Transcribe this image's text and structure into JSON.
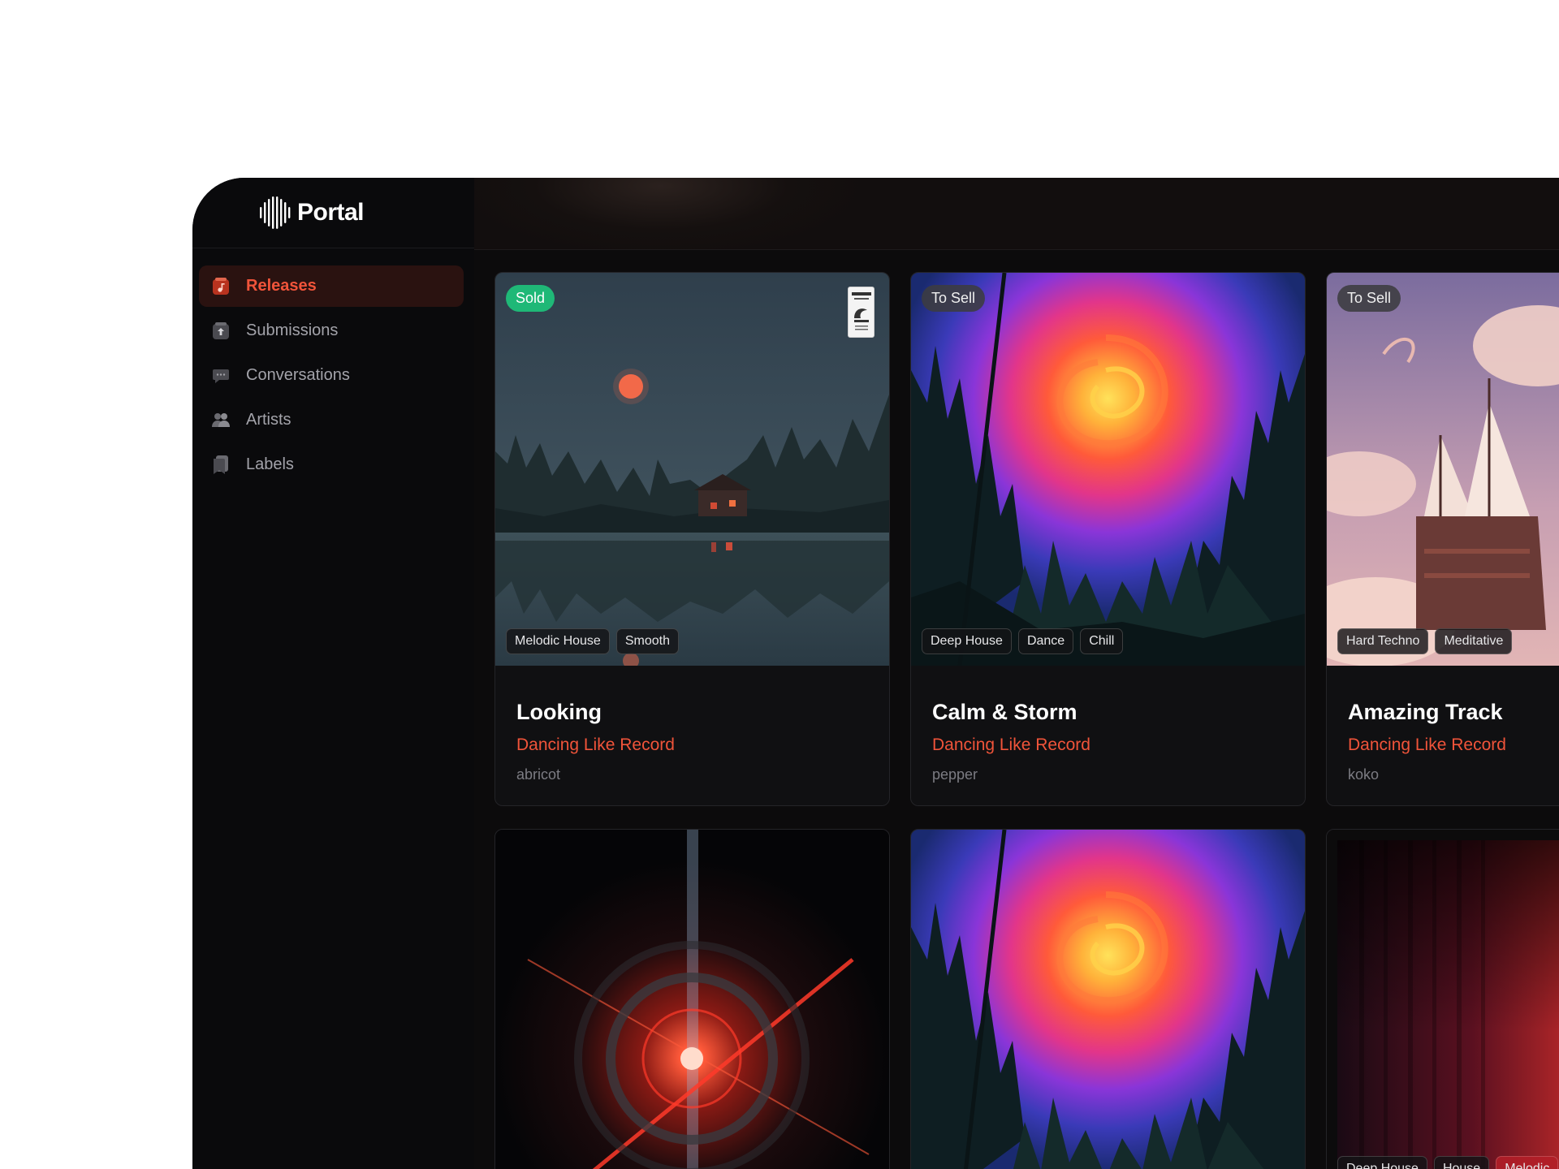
{
  "brand": {
    "name": "Portal"
  },
  "colors": {
    "accent": "#f0543a",
    "sold": "#1fb877",
    "background": "#0a0a0c"
  },
  "nav": {
    "items": [
      {
        "label": "Releases",
        "icon": "releases-icon",
        "active": true
      },
      {
        "label": "Submissions",
        "icon": "upload-icon",
        "active": false
      },
      {
        "label": "Conversations",
        "icon": "chat-icon",
        "active": false
      },
      {
        "label": "Artists",
        "icon": "artists-icon",
        "active": false
      },
      {
        "label": "Labels",
        "icon": "bookmark-icon",
        "active": false
      }
    ]
  },
  "releases": [
    {
      "title": "Looking",
      "label": "Dancing Like Record",
      "artist": "abricot",
      "status": "Sold",
      "tags": [
        "Melodic House",
        "Smooth"
      ],
      "art": "lake-night"
    },
    {
      "title": "Calm & Storm",
      "label": "Dancing Like Record",
      "artist": "pepper",
      "status": "To Sell",
      "tags": [
        "Deep House",
        "Dance",
        "Chill"
      ],
      "art": "forest-vortex"
    },
    {
      "title": "Amazing Track",
      "label": "Dancing Like Record",
      "artist": "koko",
      "status": "To Sell",
      "tags": [
        "Hard Techno",
        "Meditative"
      ],
      "art": "sky-ship"
    },
    {
      "title": "",
      "label": "",
      "artist": "",
      "status": "",
      "tags": [],
      "art": "red-burst"
    },
    {
      "title": "",
      "label": "",
      "artist": "",
      "status": "",
      "tags": [],
      "art": "forest-vortex"
    },
    {
      "title": "",
      "label": "",
      "artist": "",
      "status": "",
      "tags": [
        "Deep House",
        "House",
        "Melodic"
      ],
      "art": "red-curtain"
    }
  ]
}
